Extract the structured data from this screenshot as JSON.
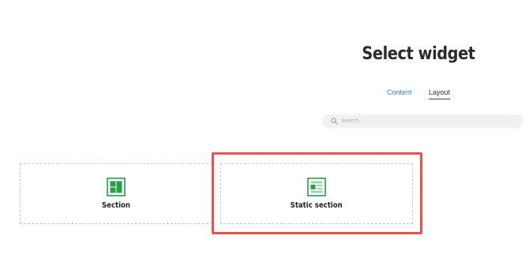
{
  "header": {
    "title": "Select widget"
  },
  "tabs": [
    {
      "label": "Content",
      "active": false
    },
    {
      "label": "Layout",
      "active": true
    }
  ],
  "search": {
    "placeholder": "Search...",
    "value": "",
    "icon": "search-icon"
  },
  "widgets": [
    {
      "label": "Section",
      "icon": "section-icon"
    },
    {
      "label": "Static section",
      "icon": "static-section-icon",
      "highlighted": true
    }
  ],
  "colors": {
    "accent_blue": "#2a7fd4",
    "icon_green": "#2a9d4a",
    "highlight_red": "#e4544a"
  }
}
